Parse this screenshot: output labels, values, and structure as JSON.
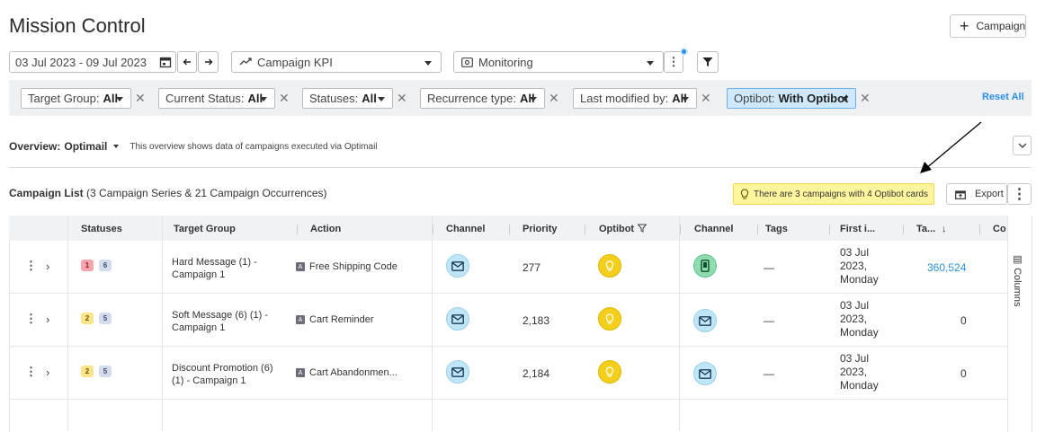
{
  "header": {
    "title": "Mission Control",
    "campaign_button": "Campaign"
  },
  "toolbar": {
    "date_range": "03 Jul 2023 - 09 Jul 2023",
    "kpi_select": "Campaign KPI",
    "view_select": "Monitoring"
  },
  "filters": {
    "items": [
      {
        "label": "Target Group:",
        "value": "All"
      },
      {
        "label": "Current Status:",
        "value": "All"
      },
      {
        "label": "Statuses:",
        "value": "All"
      },
      {
        "label": "Recurrence type:",
        "value": "All"
      },
      {
        "label": "Last modified by:",
        "value": "All"
      },
      {
        "label": "Optibot:",
        "value": "With Optibot"
      }
    ],
    "reset_label": "Reset All"
  },
  "overview": {
    "label": "Overview:",
    "value": "Optimail",
    "description": "This overview shows data of campaigns executed via Optimail"
  },
  "campaign_list": {
    "title": "Campaign List",
    "summary": "(3 Campaign Series & 21 Campaign Occurrences)",
    "notice": "There are 3 campaigns with 4 Optibot cards",
    "export_label": "Export"
  },
  "table": {
    "headers": [
      "Statuses",
      "Target Group",
      "Action",
      "Channel",
      "Priority",
      "Optibot",
      "Channel",
      "Tags",
      "First i...",
      "Ta...",
      "Co"
    ],
    "rows": [
      {
        "badges": [
          "1",
          "6"
        ],
        "target_group": "Hard Message (1) - Campaign 1",
        "action": "Free Shipping Code",
        "priority": "277",
        "tags": "—",
        "first_date": [
          "03 Jul",
          "2023,",
          "Monday"
        ],
        "target": "360,524"
      },
      {
        "badges": [
          "2",
          "5"
        ],
        "target_group": "Soft Message (6) (1) - Campaign 1",
        "action": "Cart Reminder",
        "priority": "2,183",
        "tags": "—",
        "first_date": [
          "03 Jul",
          "2023,",
          "Monday"
        ],
        "target": "0"
      },
      {
        "badges": [
          "2",
          "5"
        ],
        "target_group": "Discount Promotion (6) (1) - Campaign 1",
        "action": "Cart Abandonmen...",
        "priority": "2,184",
        "tags": "—",
        "first_date": [
          "03 Jul",
          "2023,",
          "Monday"
        ],
        "target": "0"
      }
    ],
    "action_badge": "A",
    "columns_panel": "Columns"
  },
  "colors": {
    "accent": "#2b8fe6",
    "notice_bg": "#fff59d",
    "filter_highlight": "#cfe8fb"
  }
}
